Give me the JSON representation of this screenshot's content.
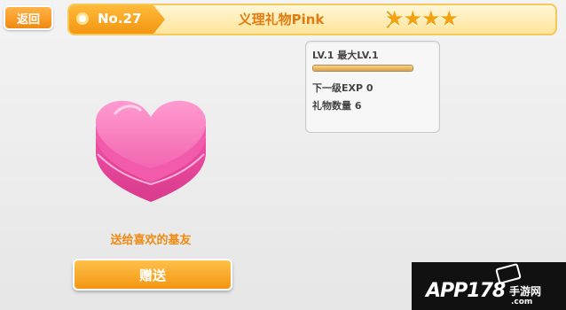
{
  "header": {
    "back_label": "返回",
    "gift_number": "No.27",
    "gift_name": "义理礼物Pink",
    "stars": "★★★★"
  },
  "info": {
    "level": "LV.1 最大LV.1",
    "exp_progress": 1.0,
    "next_exp": "下一级EXP 0",
    "gift_count": "礼物数量 6"
  },
  "main": {
    "hint": "送给喜欢的基友",
    "gift_button_label": "赠送"
  },
  "colors": {
    "accent_orange": "#f39612",
    "heart_pink": "#f266b0"
  },
  "watermark": {
    "brand": "APP178",
    "sub": "手游网",
    "domain": ".com"
  }
}
